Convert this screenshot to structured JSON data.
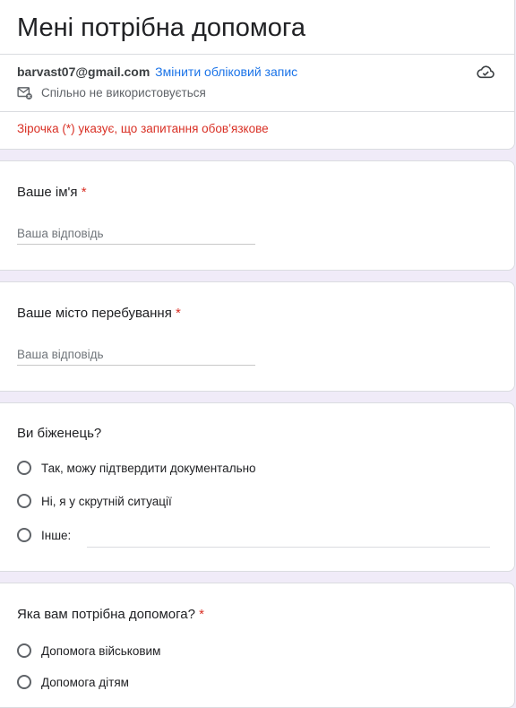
{
  "form": {
    "title": "Мені потрібна допомога",
    "account_email": "barvast07@gmail.com",
    "switch_account": "Змінити обліковий запис",
    "not_shared": "Спільно не використовується",
    "required_note": "Зірочка (*) указує, що запитання обов’язкове"
  },
  "questions": {
    "name": {
      "title": "Ваше ім'я",
      "star": "*",
      "placeholder": "Ваша відповідь"
    },
    "city": {
      "title": "Ваше місто перебування",
      "star": "*",
      "placeholder": "Ваша відповідь"
    },
    "refugee": {
      "title": "Ви біженець?",
      "options": [
        "Так, можу підтвердити документально",
        "Ні, я у скрутній ситуації",
        "Інше:"
      ]
    },
    "help": {
      "title": "Яка вам потрібна допомога?",
      "star": "*",
      "options": [
        "Допомога військовим",
        "Допомога дітям"
      ]
    }
  }
}
